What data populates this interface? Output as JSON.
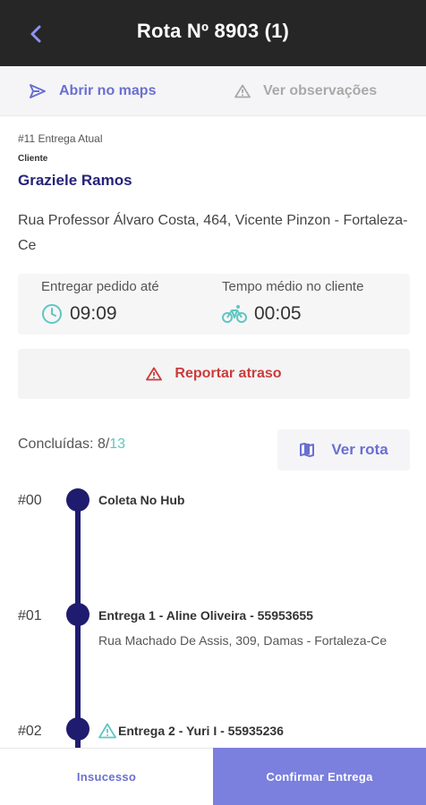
{
  "header": {
    "title": "Rota Nº 8903 (1)",
    "back_icon": "chevron-left-icon"
  },
  "actions": {
    "maps_label": "Abrir no maps",
    "maps_icon": "send-icon",
    "observations_label": "Ver observações",
    "observations_icon": "warning-icon"
  },
  "delivery": {
    "current_label": "#11 Entrega Atual",
    "client_label": "Cliente",
    "client_name": "Graziele Ramos",
    "address": "Rua Professor Álvaro Costa, 464, Vicente Pinzon - Fortaleza-Ce"
  },
  "times": {
    "deliver_by_label": "Entregar pedido até",
    "deliver_by_value": "09:09",
    "avg_time_label": "Tempo médio no cliente",
    "avg_time_value": "00:05"
  },
  "delay_button": {
    "label": "Reportar atraso"
  },
  "progress": {
    "label": "Concluídas: 8/",
    "total": "13",
    "route_button": "Ver rota"
  },
  "stops": [
    {
      "number": "#00",
      "title": "Coleta No Hub",
      "address": ""
    },
    {
      "number": "#01",
      "title": "Entrega 1 - Aline Oliveira - 55953655",
      "address": "Rua Machado De Assis, 309, Damas - Fortaleza-Ce"
    },
    {
      "number": "#02",
      "title": "Entrega 2 - Yuri I - 55935236",
      "address": ""
    }
  ],
  "bottom": {
    "fail_label": "Insucesso",
    "confirm_label": "Confirmar Entrega"
  },
  "colors": {
    "header_bg": "#262626",
    "accent": "#6a6fd1",
    "navy": "#1f1c6f",
    "teal": "#5ec7c3",
    "danger": "#cc3b3b",
    "confirm_bg": "#7b7fde"
  }
}
